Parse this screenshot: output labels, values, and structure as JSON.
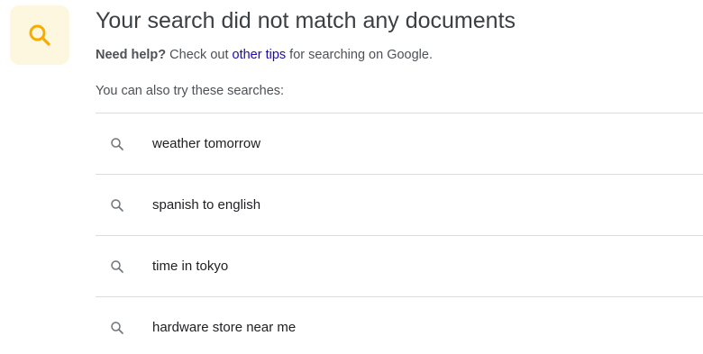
{
  "no_results": {
    "title": "Your search did not match any documents",
    "help_bold": "Need help?",
    "help_middle": " Check out ",
    "help_link": "other tips",
    "help_tail": " for searching on Google.",
    "also_try": "You can also try these searches:"
  },
  "suggestions": [
    {
      "label": "weather tomorrow",
      "icon": "search-icon"
    },
    {
      "label": "spanish to english",
      "icon": "search-icon"
    },
    {
      "label": "time in tokyo",
      "icon": "search-icon"
    },
    {
      "label": "hardware store near me",
      "icon": "search-icon"
    }
  ],
  "colors": {
    "hero_icon_bg": "#fef7e0",
    "hero_icon": "#f9ab00",
    "link": "#1a0dab",
    "divider": "#dadce0",
    "suggestion_icon": "#70757a"
  }
}
